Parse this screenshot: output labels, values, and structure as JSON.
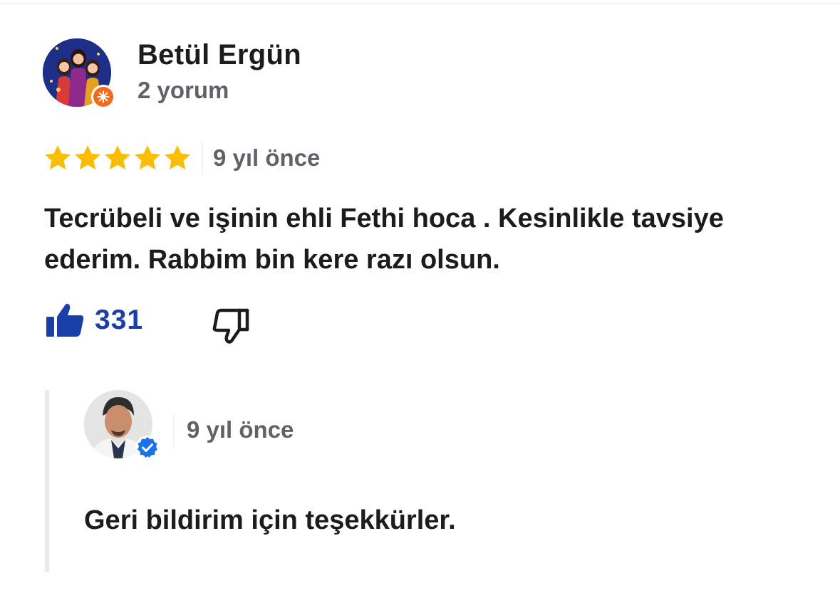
{
  "review": {
    "author_name": "Betül Ergün",
    "author_meta": "2 yorum",
    "rating": 5,
    "rating_max": 5,
    "time_ago": "9 yıl önce",
    "text": "Tecrübeli ve işinin ehli Fethi hoca . Kesinlikle tavsiye ederim. Rabbim bin kere razı olsun.",
    "like_count": "331",
    "icons": {
      "avatar_badge": "local-guide-icon",
      "like": "thumbs-up-filled-icon",
      "dislike": "thumbs-down-outline-icon",
      "star": "star-icon"
    }
  },
  "reply": {
    "time_ago": "9 yıl önce",
    "text": "Geri bildirim için teşekkürler.",
    "icons": {
      "verified": "verified-check-icon"
    }
  },
  "colors": {
    "star": "#fbbc04",
    "like": "#1a3fa8",
    "muted_text": "#5f6368",
    "badge_orange": "#f26b1d",
    "verified_blue": "#1a73e8"
  }
}
